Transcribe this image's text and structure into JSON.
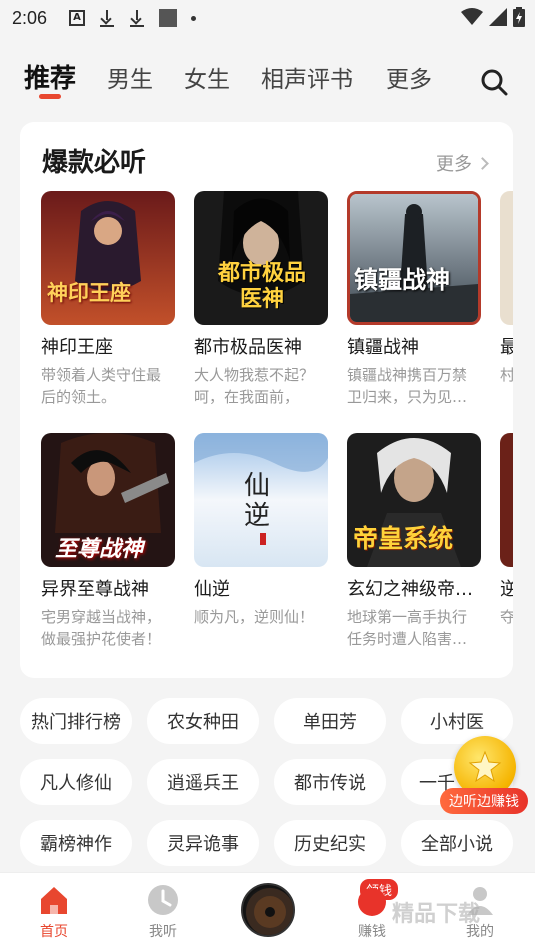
{
  "status_bar": {
    "time": "2:06",
    "icons": [
      "a-box-icon",
      "download-icon",
      "download-icon",
      "square-icon",
      "dot-icon"
    ],
    "right_icons": [
      "wifi-icon",
      "signal-icon",
      "battery-icon"
    ]
  },
  "top_nav": {
    "tabs": [
      {
        "label": "推荐",
        "active": true
      },
      {
        "label": "男生",
        "active": false
      },
      {
        "label": "女生",
        "active": false
      },
      {
        "label": "相声评书",
        "active": false
      },
      {
        "label": "更多",
        "active": false
      }
    ],
    "accent_color": "#e8472f"
  },
  "featured": {
    "title": "爆款必听",
    "more_label": "更多",
    "books": [
      {
        "title": "神印王座",
        "desc": "带领着人类守住最后的领土。",
        "cover_text": "神印王座"
      },
      {
        "title": "都市极品医神",
        "desc": "大人物我惹不起？呵，在我面前，",
        "cover_text": "都市极品医神"
      },
      {
        "title": "镇疆战神",
        "desc": "镇疆战神携百万禁卫归来，只为见…",
        "cover_text": "镇疆战神"
      },
      {
        "title": "最",
        "desc": "村豪",
        "cover_text": ""
      },
      {
        "title": "异界至尊战神",
        "desc": "宅男穿越当战神，做最强护花使者！",
        "cover_text": "至尊战神"
      },
      {
        "title": "仙逆",
        "desc": "顺为凡，逆则仙！",
        "cover_text": "仙逆"
      },
      {
        "title": "玄幻之神级帝…",
        "desc": "地球第一高手执行任务时遭人陷害…",
        "cover_text": "帝皇系统"
      },
      {
        "title": "逆",
        "desc": "夺乱",
        "cover_text": ""
      }
    ]
  },
  "tags": [
    "热门排行榜",
    "农女种田",
    "单田芳",
    "小村医",
    "凡人修仙",
    "逍遥兵王",
    "都市传说",
    "一千",
    "霸榜神作",
    "灵异诡事",
    "历史纪实",
    "全部小说"
  ],
  "float_button": {
    "label": "边听边赚钱"
  },
  "bottom_nav": {
    "items": [
      {
        "label": "首页",
        "icon": "home-icon",
        "active": true
      },
      {
        "label": "我听",
        "icon": "clock-icon",
        "active": false
      },
      {
        "label": "",
        "icon": "now-playing-disc",
        "active": false
      },
      {
        "label": "赚钱",
        "icon": "money-icon",
        "active": false
      },
      {
        "label": "我的",
        "icon": "person-icon",
        "active": false
      }
    ],
    "badge": "领钱"
  },
  "watermark": "精品下载"
}
